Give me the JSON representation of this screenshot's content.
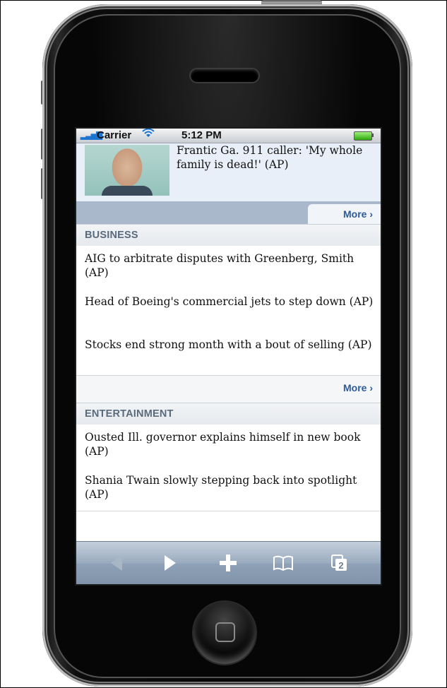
{
  "status": {
    "carrier": "Carrier",
    "time": "5:12 PM"
  },
  "lead": {
    "headline": "Frantic Ga. 911 caller: 'My whole family is dead!' (AP)",
    "more_label": "More  ›"
  },
  "sections": [
    {
      "title": "BUSINESS",
      "stories": [
        "AIG to arbitrate disputes with Greenberg, Smith (AP)",
        "Head of Boeing's commercial jets to step down (AP)",
        "Stocks end strong month with a bout of selling (AP)"
      ],
      "more_label": "More  ›"
    },
    {
      "title": "ENTERTAINMENT",
      "stories": [
        "Ousted Ill. governor explains himself in new book (AP)",
        "Shania Twain slowly stepping back into spotlight (AP)"
      ]
    }
  ],
  "toolbar": {
    "tabs_count": "2"
  },
  "icons": {
    "signal": "signal-bars-icon",
    "wifi": "wifi-icon",
    "battery": "battery-icon"
  }
}
